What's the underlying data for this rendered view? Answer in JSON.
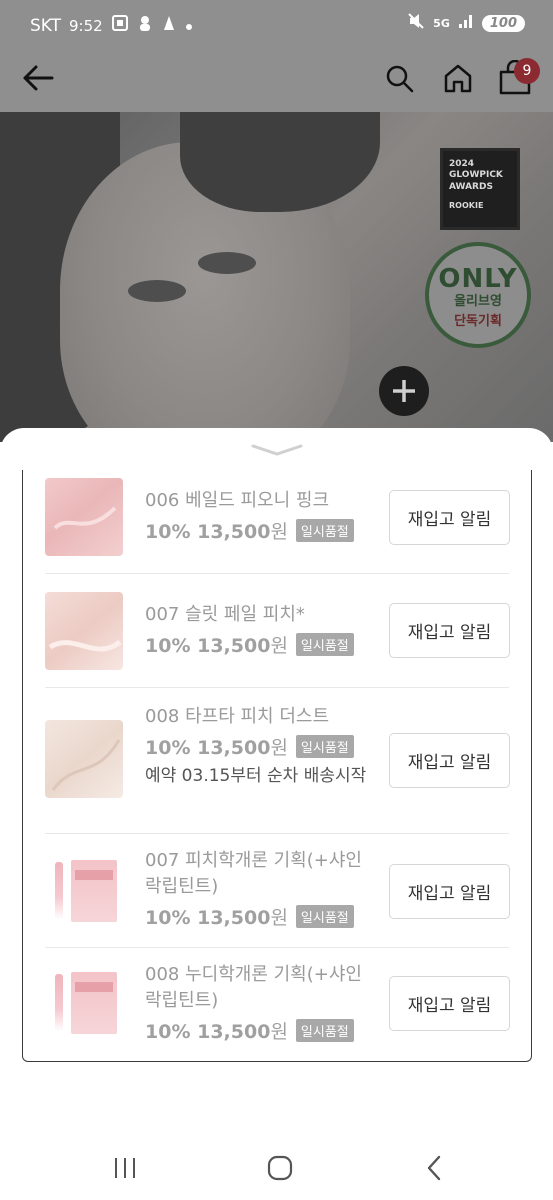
{
  "status_bar": {
    "carrier": "SKT",
    "time": "9:52",
    "network": "5G",
    "battery": "100"
  },
  "header": {
    "cart_count": "9"
  },
  "hero": {
    "award_year": "2024",
    "award_line1": "GLOWPICK",
    "award_line2": "AWARDS",
    "award_rookie": "ROOKIE",
    "only_label": "ONLY",
    "only_sub1": "올리브영",
    "only_sub2": "단독기획"
  },
  "products": [
    {
      "name": "006 베일드 피오니 핑크",
      "discount": "10%",
      "price": "13,500",
      "currency": "원",
      "badge": "일시품절",
      "button": "재입고 알림"
    },
    {
      "name": "007 슬릿 페일 피치*",
      "discount": "10%",
      "price": "13,500",
      "currency": "원",
      "badge": "일시품절",
      "button": "재입고 알림"
    },
    {
      "name": "008 타프타 피치 더스트",
      "discount": "10%",
      "price": "13,500",
      "currency": "원",
      "badge": "일시품절",
      "note": "예약 03.15부터 순차 배송시작",
      "button": "재입고 알림"
    },
    {
      "name": "007 피치학개론 기획(+샤인 락립틴트)",
      "discount": "10%",
      "price": "13,500",
      "currency": "원",
      "badge": "일시품절",
      "button": "재입고 알림"
    },
    {
      "name": "008 누디학개론 기획(+샤인 락립틴트)",
      "discount": "10%",
      "price": "13,500",
      "currency": "원",
      "badge": "일시품절",
      "button": "재입고 알림"
    }
  ]
}
